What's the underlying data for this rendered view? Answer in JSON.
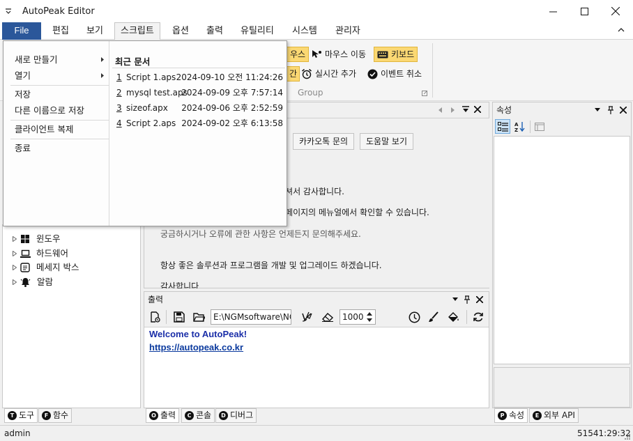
{
  "window": {
    "title": "AutoPeak Editor"
  },
  "menubar": {
    "file": "File",
    "items": [
      "편집",
      "보기",
      "스크립트",
      "옵션",
      "출력",
      "유틸리티",
      "시스템",
      "관리자"
    ]
  },
  "ribbon": {
    "mouse_partial": "우스",
    "mouse_move": "마우스 이동",
    "keyboard": "키보드",
    "partial2": "간",
    "realtime_add": "실시간 추가",
    "event_cancel": "이벤트 취소",
    "group_label": "Group"
  },
  "file_menu": {
    "items": [
      {
        "label": "새로 만들기",
        "arrow": true
      },
      {
        "label": "열기",
        "arrow": true
      },
      {
        "label": "저장",
        "arrow": false
      },
      {
        "label": "다른 이름으로 저장",
        "arrow": false
      },
      {
        "label": "클라이언트 복제",
        "arrow": false
      },
      {
        "label": "종료",
        "arrow": false
      }
    ],
    "recent_title": "최근 문서",
    "recent": [
      {
        "num": "1",
        "file": "Script 1.aps",
        "date": "2024-09-10 오전 11:24:26"
      },
      {
        "num": "2",
        "file": "mysql test.aps",
        "date": "2024-09-09 오후 7:57:14"
      },
      {
        "num": "3",
        "file": "sizeof.apx",
        "date": "2024-09-06 오후 2:52:59"
      },
      {
        "num": "4",
        "file": "Script 2.aps",
        "date": "2024-09-02 오후 6:13:58"
      }
    ]
  },
  "start_page": {
    "buttons": [
      "카카오톡 문의",
      "도움말 보기"
    ],
    "lines": [
      "주셔서 감사합니다.",
      "두페이지의 메뉴얼에서 확인할 수 있습니다.",
      "궁금하시거나 오류에 관한 사항은 언제든지 문의해주세요.",
      "항상 좋은 솔루션과 프로그램을 개발 및 업그레이드 하겠습니다.",
      "감사합니다"
    ]
  },
  "tree": {
    "items": [
      "윈도우",
      "하드웨어",
      "메세지 박스",
      "알람"
    ]
  },
  "left_tabs": [
    {
      "badge": "T",
      "label": "도구"
    },
    {
      "badge": "F",
      "label": "함수"
    }
  ],
  "output": {
    "title": "출력",
    "path": "E:\\NGMsoftware\\NG",
    "interval": "1000",
    "welcome": "Welcome to AutoPeak!",
    "link": "https://autopeak.co.kr"
  },
  "output_tabs": [
    {
      "badge": "O",
      "label": "출력"
    },
    {
      "badge": "C",
      "label": "콘솔"
    },
    {
      "badge": "D",
      "label": "디버그"
    }
  ],
  "properties": {
    "title": "속성"
  },
  "right_tabs": [
    {
      "badge": "P",
      "label": "속성"
    },
    {
      "badge": "E",
      "label": "외부 API"
    }
  ],
  "status": {
    "user": "admin",
    "coords": "51541:29:32"
  },
  "colors": {
    "file_menu_bg": "#2b579a",
    "highlight": "#fbd873",
    "link": "#0b3a9e",
    "welcome": "#1a2ea8"
  }
}
